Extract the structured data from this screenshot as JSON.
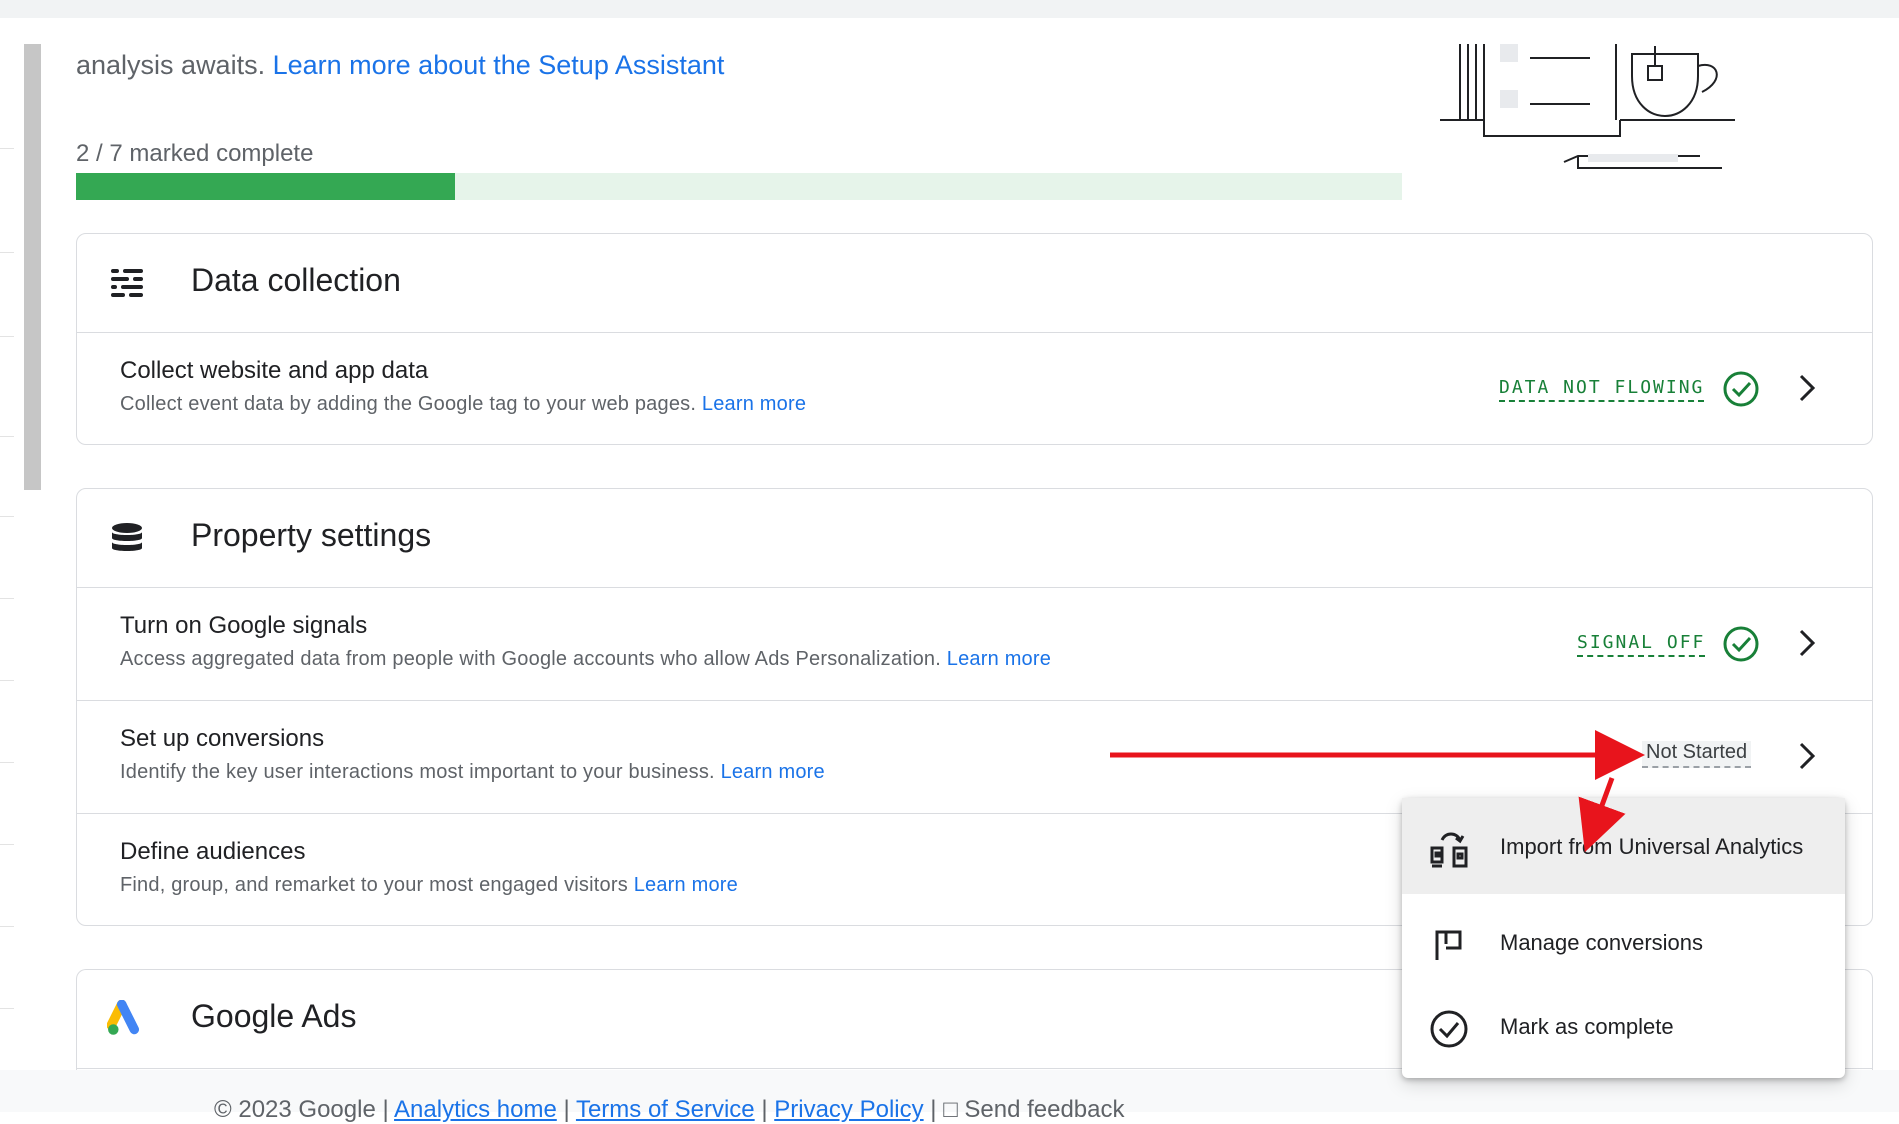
{
  "setup": {
    "intro_prefix": "analysis awaits.",
    "intro_link": "Learn more about the Setup Assistant",
    "progress_label": "2 / 7 marked complete",
    "progress_fraction": 0.2857
  },
  "sections": {
    "data_collection": {
      "title": "Data collection",
      "icon": "data-collection-icon",
      "rows": [
        {
          "title": "Collect website and app data",
          "desc": "Collect event data by adding the Google tag to your web pages.",
          "link": "Learn more",
          "status": "DATA NOT FLOWING"
        }
      ]
    },
    "property_settings": {
      "title": "Property settings",
      "icon": "database-icon",
      "rows": [
        {
          "title": "Turn on Google signals",
          "desc": "Access aggregated data from people with Google accounts who allow Ads Personalization.",
          "link": "Learn more",
          "status": "SIGNAL OFF"
        },
        {
          "title": "Set up conversions",
          "desc": "Identify the key user interactions most important to your business.",
          "link": "Learn more",
          "status": "Not Started"
        },
        {
          "title": "Define audiences",
          "desc": "Find, group, and remarket to your most engaged visitors",
          "link": "Learn more"
        }
      ]
    },
    "google_ads": {
      "title": "Google Ads",
      "icon": "google-ads-logo"
    }
  },
  "menu": {
    "items": [
      {
        "label": "Import from Universal Analytics",
        "icon": "import-icon"
      },
      {
        "label": "Manage conversions",
        "icon": "flag-icon"
      },
      {
        "label": "Mark as complete",
        "icon": "check-circle-icon"
      }
    ]
  },
  "footer": {
    "copyright": "© 2023 Google |",
    "links": [
      "Analytics home",
      "Terms of Service",
      "Privacy Policy"
    ],
    "feedback": "Send feedback"
  },
  "colors": {
    "accent_link": "#1a73e8",
    "status_green": "#188038",
    "progress_fill": "#34a853",
    "progress_track": "#e6f4ea",
    "annotation_arrow": "#e8141c"
  }
}
